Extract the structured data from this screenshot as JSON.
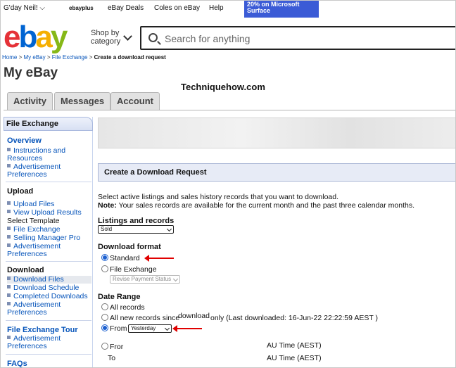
{
  "topbar": {
    "greeting": "G'day Neil!",
    "ebayplus": "ebayplus",
    "deals": "eBay Deals",
    "coles": "Coles on eBay",
    "help": "Help",
    "promo_line1": "20% on Microsoft",
    "promo_line2": "Surface"
  },
  "logo": {
    "e": "e",
    "b": "b",
    "a": "a",
    "y": "y"
  },
  "shop_by": {
    "line1": "Shop by",
    "line2": "category"
  },
  "search": {
    "placeholder": "Search for anything"
  },
  "breadcrumb": {
    "home": "Home",
    "my_ebay": "My eBay",
    "file_exchange": "File Exchange",
    "current": "Create a download request",
    "sep": ">"
  },
  "page_title": "My eBay",
  "watermark": "Techniquehow.com",
  "tabs": [
    "Activity",
    "Messages",
    "Account"
  ],
  "sidebar": {
    "header": "File Exchange",
    "overview": "Overview",
    "overview_items": [
      "Instructions and Resources",
      "Advertisement Preferences"
    ],
    "upload": "Upload",
    "upload_items": [
      "Upload Files",
      "View Upload Results"
    ],
    "select_template": "Select Template",
    "template_items": [
      "File Exchange",
      "Selling Manager Pro",
      "Advertisement Preferences"
    ],
    "download": "Download",
    "download_items": [
      "Download Files",
      "Download Schedule",
      "Completed Downloads",
      "Advertisement Preferences"
    ],
    "tour": "File Exchange Tour",
    "tour_items": [
      "Advertisement Preferences"
    ],
    "faqs": "FAQs"
  },
  "request": {
    "header": "Create a Download Request",
    "intro": "Select active listings and sales history records that you want to download.",
    "note_label": "Note:",
    "note_text": " Your sales records are available for the current month and the past three calendar months.",
    "listings_label": "Listings and records",
    "listings_value": "Sold",
    "format_label": "Download format",
    "format_standard": "Standard",
    "format_file_exchange": "File Exchange",
    "format_fe_select": "Revise Payment Status",
    "date_label": "Date Range",
    "date_all": "All records",
    "date_since": "All new records since",
    "date_since_overlay": "download",
    "date_since_tail": "only (Last downloaded: 16-Jun-22 22:22:59 AEST )",
    "date_from": "From",
    "date_from_value": "Yesterday",
    "custom_from": "Fror",
    "custom_to": "To",
    "tz_from": "AU Time (AEST)",
    "tz_to": "AU Time (AEST)"
  },
  "colors": {
    "link": "#0654ba",
    "arrow": "#e00000",
    "header_bg": "#e7ebf6"
  }
}
